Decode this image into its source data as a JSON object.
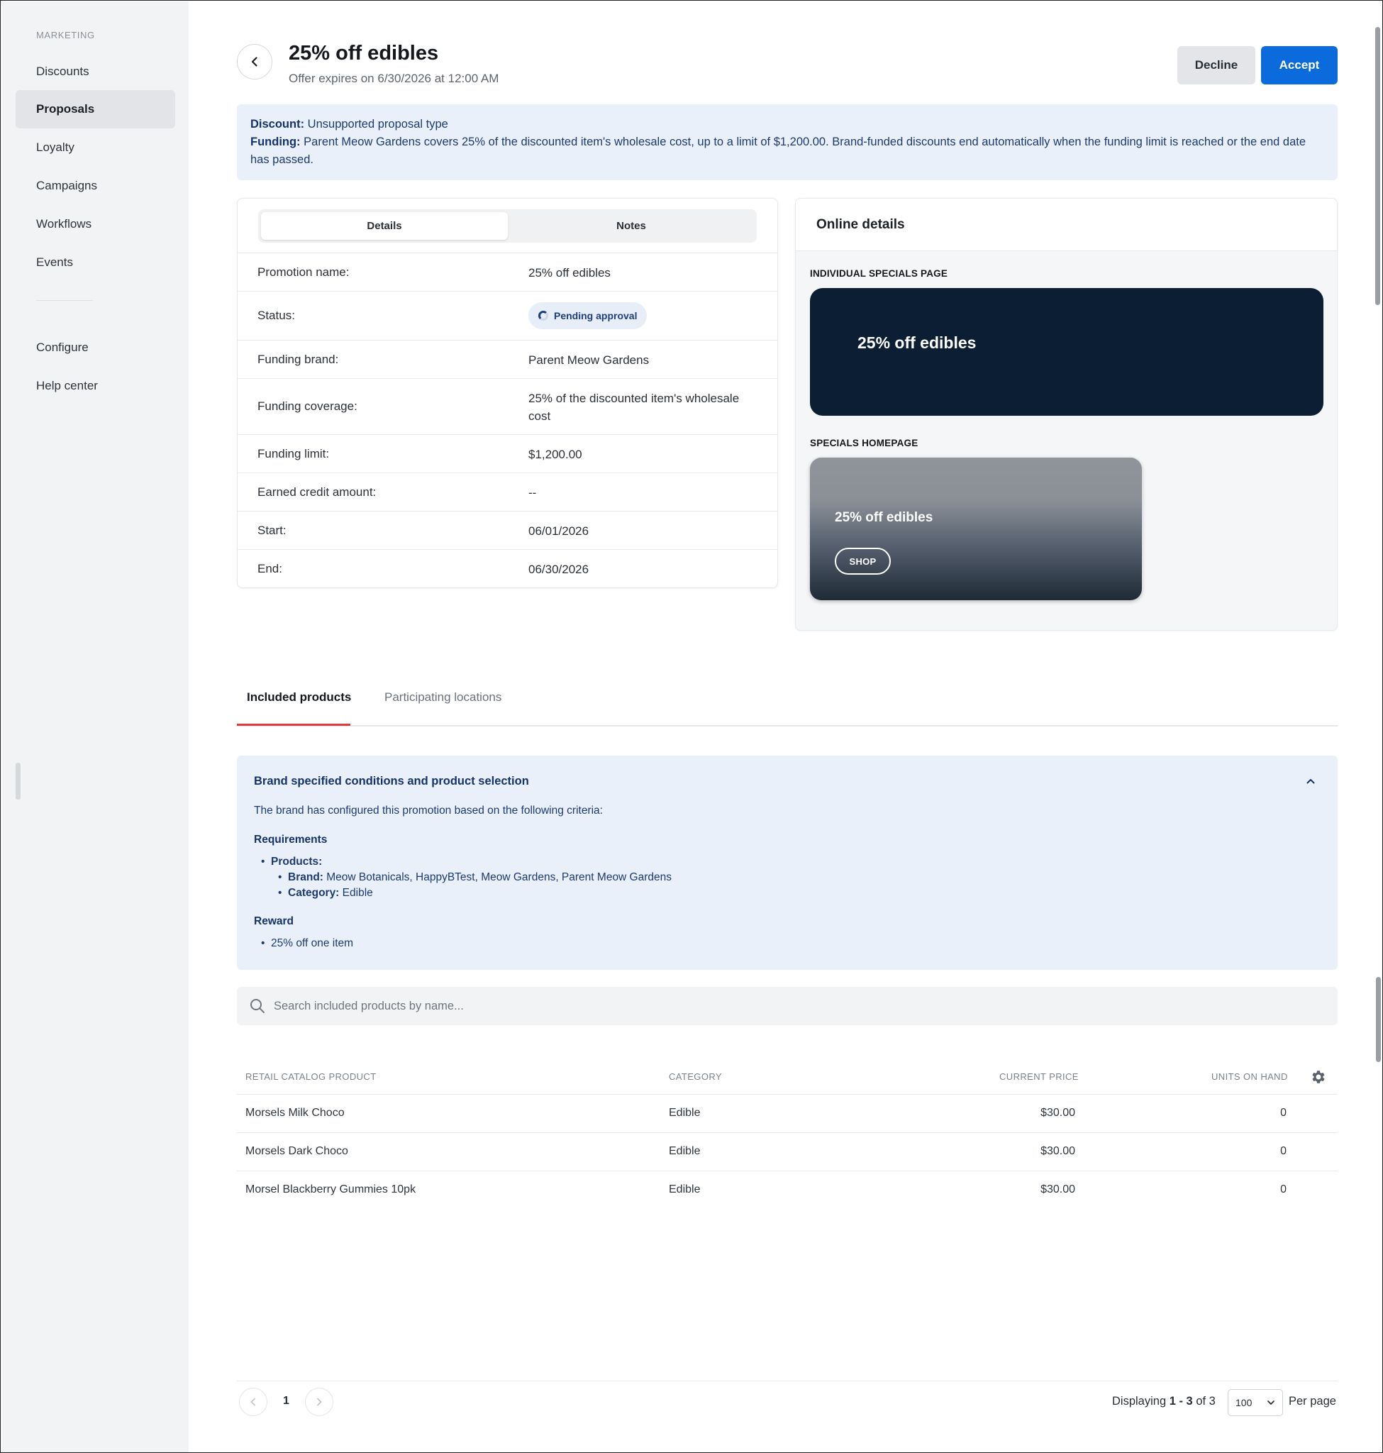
{
  "sidebar": {
    "section": "MARKETING",
    "items": [
      {
        "label": "Discounts"
      },
      {
        "label": "Proposals"
      },
      {
        "label": "Loyalty"
      },
      {
        "label": "Campaigns"
      },
      {
        "label": "Workflows"
      },
      {
        "label": "Events"
      }
    ],
    "bottom_items": [
      {
        "label": "Configure"
      },
      {
        "label": "Help center"
      }
    ]
  },
  "header": {
    "title": "25% off edibles",
    "subtitle": "Offer expires on 6/30/2026 at 12:00 AM",
    "decline_label": "Decline",
    "accept_label": "Accept"
  },
  "banner": {
    "discount_label": "Discount:",
    "discount_text": " Unsupported proposal type",
    "funding_label": "Funding:",
    "funding_text": " Parent Meow Gardens covers 25% of the discounted item's wholesale cost, up to a limit of $1,200.00. Brand-funded discounts end automatically when the funding limit is reached or the end date has passed."
  },
  "details": {
    "tabs": [
      "Details",
      "Notes"
    ],
    "rows": [
      {
        "label": "Promotion name:",
        "value": "25% off edibles"
      },
      {
        "label": "Status:",
        "value": "Pending approval"
      },
      {
        "label": "Funding brand:",
        "value": "Parent Meow Gardens"
      },
      {
        "label": "Funding coverage:",
        "value": "25% of the discounted item's wholesale cost"
      },
      {
        "label": "Funding limit:",
        "value": "$1,200.00"
      },
      {
        "label": "Earned credit amount:",
        "value": "--"
      },
      {
        "label": "Start:",
        "value": "06/01/2026"
      },
      {
        "label": "End:",
        "value": "06/30/2026"
      }
    ]
  },
  "online": {
    "title": "Online details",
    "individual_label": "INDIVIDUAL SPECIALS PAGE",
    "individual_text": "25% off edibles",
    "homepage_label": "SPECIALS HOMEPAGE",
    "homepage_text": "25% off edibles",
    "shop_label": "SHOP"
  },
  "tabs": {
    "included": "Included products",
    "locations": "Participating locations"
  },
  "conditions": {
    "title": "Brand specified conditions and product selection",
    "intro": "The brand has configured this promotion based on the following criteria:",
    "requirements_h": "Requirements",
    "products_label": "Products:",
    "brand_label": "Brand:",
    "brand_value": " Meow Botanicals, HappyBTest, Meow Gardens, Parent Meow Gardens",
    "category_label": "Category:",
    "category_value": " Edible",
    "reward_h": "Reward",
    "reward_item": "25% off one item"
  },
  "search": {
    "placeholder": "Search included products by name..."
  },
  "table": {
    "headers": [
      "RETAIL CATALOG PRODUCT",
      "CATEGORY",
      "CURRENT PRICE",
      "UNITS ON HAND"
    ],
    "rows": [
      {
        "product": "Morsels Milk Choco",
        "category": "Edible",
        "price": "$30.00",
        "units": "0"
      },
      {
        "product": "Morsels Dark Choco",
        "category": "Edible",
        "price": "$30.00",
        "units": "0"
      },
      {
        "product": "Morsel Blackberry Gummies 10pk",
        "category": "Edible",
        "price": "$30.00",
        "units": "0"
      }
    ]
  },
  "pagination": {
    "page": "1",
    "displaying_prefix": "Displaying ",
    "range": "1 - 3",
    "of_text": " of 3",
    "per_page_value": "100",
    "per_page_label": "Per page"
  },
  "colors": {
    "accent": "#0b6bdc",
    "tab_underline": "#e03a3e",
    "banner_bg": "#eaf0f9",
    "dark_banner": "#0c1e33"
  }
}
